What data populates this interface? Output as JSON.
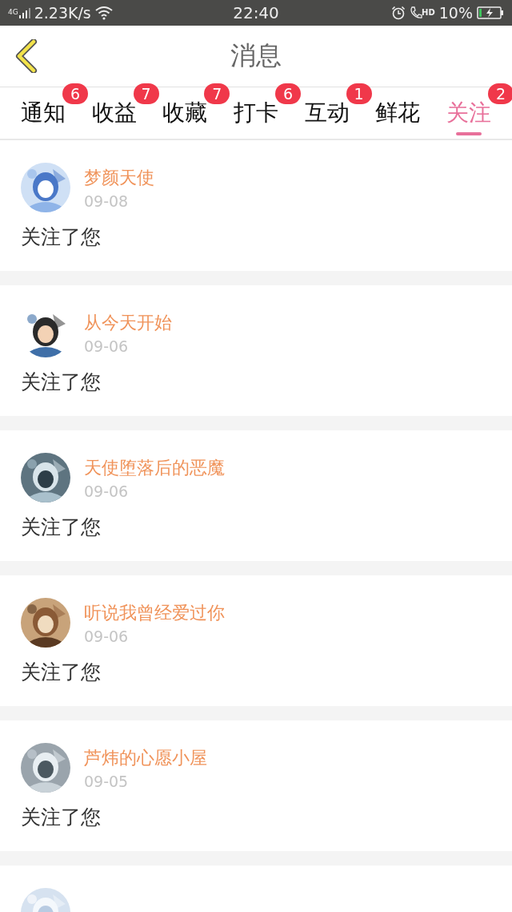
{
  "status_bar": {
    "network": "4G",
    "speed": "2.23K/s",
    "time": "22:40",
    "call_tag": "HD",
    "battery": "10%"
  },
  "header": {
    "title": "消息"
  },
  "tabs": [
    {
      "label": "通知",
      "badge": "6",
      "selected": false
    },
    {
      "label": "收益",
      "badge": "7",
      "selected": false
    },
    {
      "label": "收藏",
      "badge": "7",
      "selected": false
    },
    {
      "label": "打卡",
      "badge": "6",
      "selected": false
    },
    {
      "label": "互动",
      "badge": "1",
      "selected": false
    },
    {
      "label": "鲜花",
      "selected": false
    },
    {
      "label": "关注",
      "badge": "2",
      "selected": true
    }
  ],
  "messages": [
    {
      "name": "梦颜天使",
      "date": "09-08",
      "text": "关注了您",
      "avatar": {
        "kind": "picture"
      }
    },
    {
      "name": "从今天开始",
      "date": "09-06",
      "text": "关注了您",
      "avatar": {
        "kind": "picture"
      }
    },
    {
      "name": "天使堕落后的恶魔",
      "date": "09-06",
      "text": "关注了您",
      "avatar": {
        "kind": "picture"
      }
    },
    {
      "name": "听说我曾经爱过你",
      "date": "09-06",
      "text": "关注了您",
      "avatar": {
        "kind": "picture"
      }
    },
    {
      "name": "芦炜的心愿小屋",
      "date": "09-05",
      "text": "关注了您",
      "avatar": {
        "kind": "picture"
      }
    },
    {
      "avatar": {
        "kind": "picture"
      }
    }
  ]
}
